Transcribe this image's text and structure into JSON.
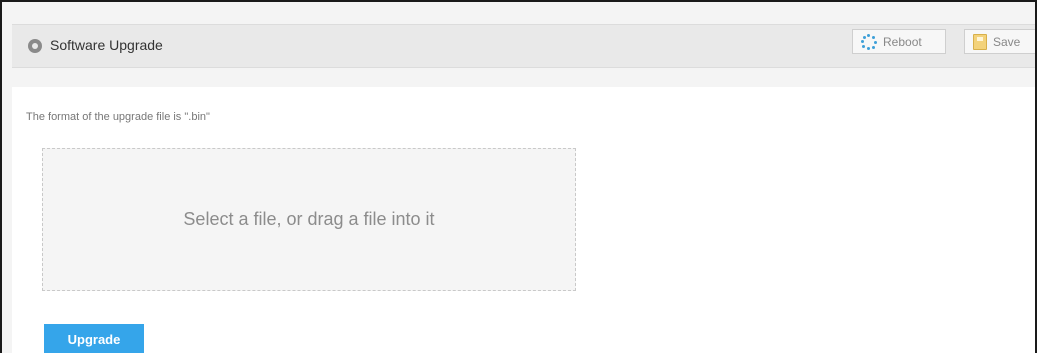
{
  "header": {
    "title": "Software Upgrade",
    "icon": "location-pin-icon"
  },
  "toolbar": {
    "reboot_label": "Reboot",
    "reboot_icon": "spinner-icon",
    "save_label": "Save",
    "save_icon": "save-icon"
  },
  "content": {
    "hint": "The format of the upgrade file is \".bin\"",
    "dropzone_text": "Select a file, or drag a file into it",
    "upgrade_label": "Upgrade"
  },
  "colors": {
    "accent": "#35a5ea",
    "header_bg": "#e9e9e9",
    "reboot_icon": "#3ea0d8",
    "save_icon": "#f3d27a"
  }
}
